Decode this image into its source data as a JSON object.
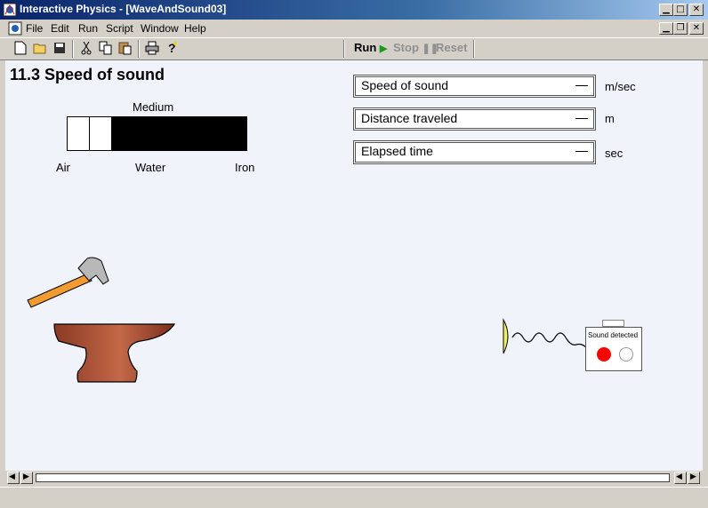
{
  "window": {
    "title": "Interactive Physics - [WaveAndSound03]"
  },
  "menu": [
    {
      "label": "File"
    },
    {
      "label": "Edit"
    },
    {
      "label": "Run"
    },
    {
      "label": "Script"
    },
    {
      "label": "Window"
    },
    {
      "label": "Help"
    }
  ],
  "toolbar": {
    "icons": [
      "new-icon",
      "open-icon",
      "save-icon",
      "cut-icon",
      "copy-icon",
      "paste-icon",
      "print-icon",
      "help-icon"
    ],
    "run_label": "Run",
    "stop_label": "Stop",
    "reset_label": "Reset"
  },
  "simulation": {
    "heading": "11.3 Speed of sound",
    "medium_label": "Medium",
    "medium_options": [
      "Air",
      "Water",
      "Iron"
    ],
    "medium_selected": "Air",
    "meters": [
      {
        "label": "Speed of sound",
        "value": "—",
        "unit": "m/sec"
      },
      {
        "label": "Distance traveled",
        "value": "—",
        "unit": "m"
      },
      {
        "label": "Elapsed time",
        "value": "—",
        "unit": "sec"
      }
    ],
    "detector_label": "Sound detected"
  },
  "colors": {
    "title_bar": "#0a246a",
    "canvas_bg": "#f0f4fa",
    "anvil": "#b0553a",
    "hammer_handle": "#f29b30",
    "detector_red": "#ff0000",
    "microphone": "#f0f060",
    "run_green": "#1a9a1a"
  }
}
